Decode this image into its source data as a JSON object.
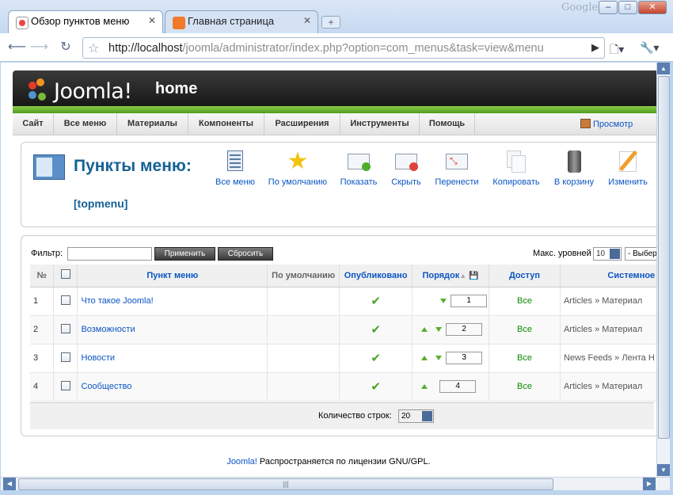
{
  "browser": {
    "tabs": [
      {
        "label": "Обзор пунктов меню",
        "active": true
      },
      {
        "label": "Главная страница",
        "active": false
      }
    ],
    "brand": "Google",
    "url_host": "http://localhost",
    "url_path": "/joomla/administrator/index.php?option=com_menus&task=view&menu"
  },
  "joomla": {
    "logo": "Joomla!",
    "site_name": "home",
    "menu": [
      "Сайт",
      "Все меню",
      "Материалы",
      "Компоненты",
      "Расширения",
      "Инструменты",
      "Помощь"
    ],
    "preview": "Просмотр"
  },
  "toolbar": {
    "title": "Пункты меню:",
    "subtitle": "[topmenu]",
    "buttons": [
      "Все меню",
      "По умолчанию",
      "Показать",
      "Скрыть",
      "Перенести",
      "Копировать",
      "В корзину",
      "Изменить"
    ]
  },
  "filter": {
    "label": "Фильтр:",
    "value": "",
    "apply": "Применить",
    "reset": "Сбросить",
    "levels_label": "Макс. уровней",
    "levels_value": "10",
    "select_value": "- Выбер"
  },
  "table": {
    "headers": [
      "№",
      "",
      "Пункт меню",
      "По умолчанию",
      "Опубликовано",
      "Порядок",
      "Доступ",
      "Системное и"
    ],
    "rows": [
      {
        "num": "1",
        "name": "Что такое Joomla!",
        "published": "✔",
        "order": "1",
        "access": "Все",
        "type": "Articles » Материал"
      },
      {
        "num": "2",
        "name": "Возможности",
        "published": "✔",
        "order": "2",
        "access": "Все",
        "type": "Articles » Материал"
      },
      {
        "num": "3",
        "name": "Новости",
        "published": "✔",
        "order": "3",
        "access": "Все",
        "type": "News Feeds » Лента Н"
      },
      {
        "num": "4",
        "name": "Сообщество",
        "published": "✔",
        "order": "4",
        "access": "Все",
        "type": "Articles » Материал"
      }
    ],
    "rows_label": "Количество строк:",
    "rows_value": "20"
  },
  "footer": {
    "link": "Joomla!",
    "text": " Распространяется по лицензии GNU/GPL."
  }
}
